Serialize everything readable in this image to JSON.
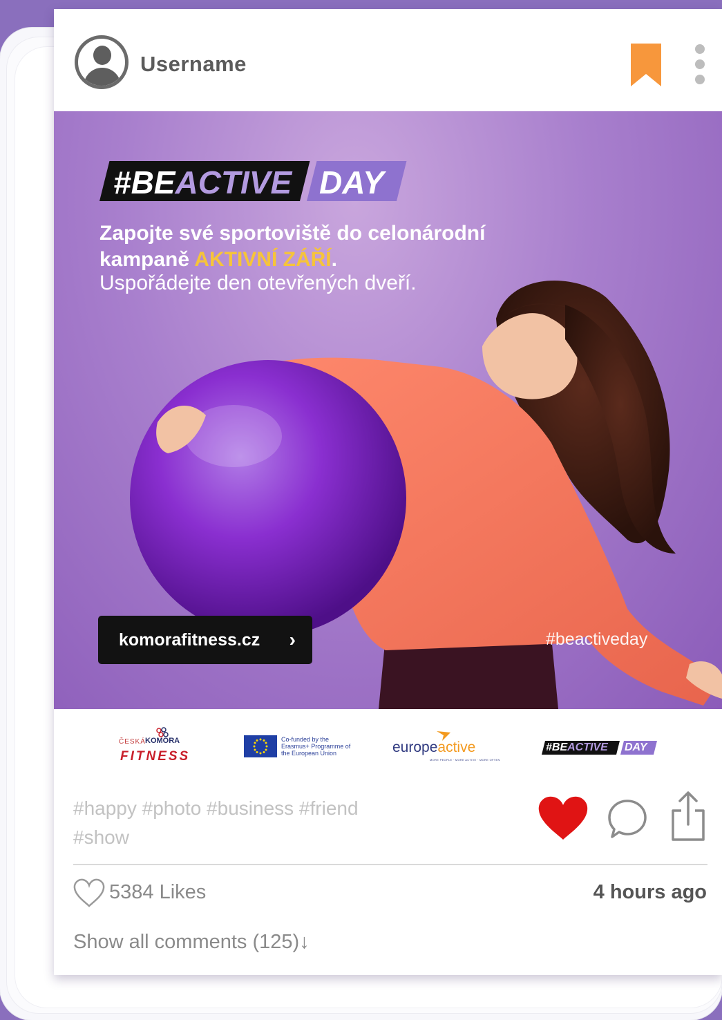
{
  "post": {
    "username": "Username",
    "campaign_tag_part1": "#BE",
    "campaign_tag_part2": "ACTIVE",
    "campaign_tag_day": "DAY",
    "headline_line1": "Zapojte své sportoviště do celonárodní",
    "headline_line2_prefix": "kampaně ",
    "headline_highlight": "AKTIVNÍ ZÁŘÍ",
    "headline_line2_suffix": ".",
    "subline": "Uspořádejte den otevřených dveří.",
    "website_button": "komorafitness.cz",
    "website_chevron": "›",
    "photo_hashtag": "#beactiveday",
    "caption": "#happy #photo #business #friend #show",
    "likes": "5384 Likes",
    "time": "4 hours ago",
    "show_comments": "Show all comments (125)",
    "comments_arrow": "↓"
  },
  "logos": {
    "ceska_small": "ČESKÁ",
    "ceska_komora": "KOMORA",
    "ceska_fitness": "FITNESS",
    "eu_text": "Co-funded by the Erasmus+ Programme of the European Union",
    "europeactive_prefix": "europe",
    "europeactive_suffix": "active",
    "europeactive_tagline": "MORE PEOPLE · MORE ACTIVE · MORE OFTEN",
    "beactive_part1": "#BE",
    "beactive_part2": "ACTIVE",
    "beactive_day": "DAY"
  },
  "icons": {
    "avatar": "user-avatar-icon",
    "bookmark": "bookmark-icon",
    "more": "more-vertical-icon",
    "like": "heart-filled-icon",
    "comment": "comment-bubble-icon",
    "share": "share-icon",
    "likes_outline": "heart-outline-icon"
  },
  "colors": {
    "background": "#8a6fbd",
    "bookmark": "#f7973c",
    "heart": "#e01414",
    "highlight": "#f6c43a",
    "campaign_purple": "#8e72cf"
  }
}
